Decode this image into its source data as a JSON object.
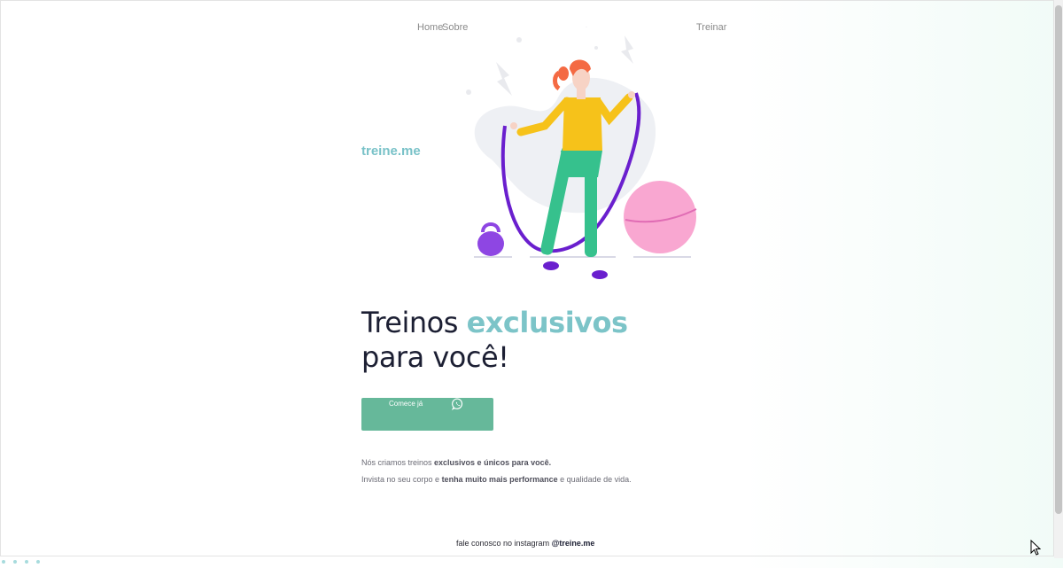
{
  "nav": {
    "home": "Home",
    "sobre": "Sobre",
    "treinar": "Treinar"
  },
  "brand": "treine.me",
  "hero": {
    "headline_part1": "Treinos ",
    "headline_accent": "exclusivos",
    "headline_part2": "para você!"
  },
  "cta": {
    "label": "Comece já",
    "icon": "whatsapp-icon"
  },
  "description": {
    "line1_pre": "Nós criamos treinos ",
    "line1_bold": "exclusivos e únicos para você.",
    "line2_pre": "Invista no seu corpo e ",
    "line2_bold": "tenha muito mais performance",
    "line2_post": " e qualidade de vida."
  },
  "footer": {
    "pre": "fale conosco no instagram ",
    "handle": "@treine.me"
  },
  "colors": {
    "accent": "#7cc4c8",
    "button": "#66b89a",
    "headline": "#1c1f33",
    "brand": "#79c2c8"
  }
}
